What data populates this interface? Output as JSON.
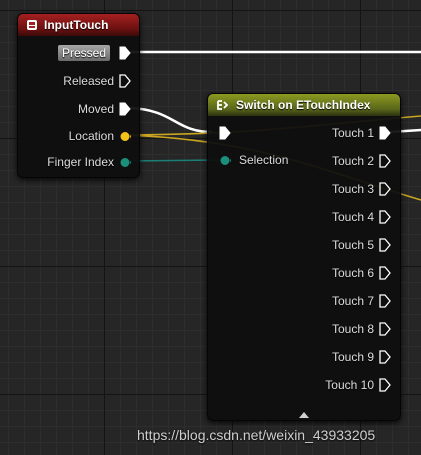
{
  "nodes": {
    "input_touch": {
      "title": "InputTouch",
      "pins": {
        "pressed": "Pressed",
        "released": "Released",
        "moved": "Moved",
        "location": "Location",
        "finger_index": "Finger Index"
      }
    },
    "switch_on_etouchindex": {
      "title": "Switch on ETouchIndex",
      "inputs": {
        "selection": "Selection"
      },
      "outputs": [
        "Touch 1",
        "Touch 2",
        "Touch 3",
        "Touch 4",
        "Touch 5",
        "Touch 6",
        "Touch 7",
        "Touch 8",
        "Touch 9",
        "Touch 10"
      ]
    }
  },
  "colors": {
    "exec_wire": "#ffffff",
    "location_pin": "#f2c21b",
    "finger_index_pin": "#1a8f7a",
    "location_wire": "#c9a520",
    "finger_wire": "#1b7f78"
  },
  "watermark": "https://blog.csdn.net/weixin_43933205"
}
